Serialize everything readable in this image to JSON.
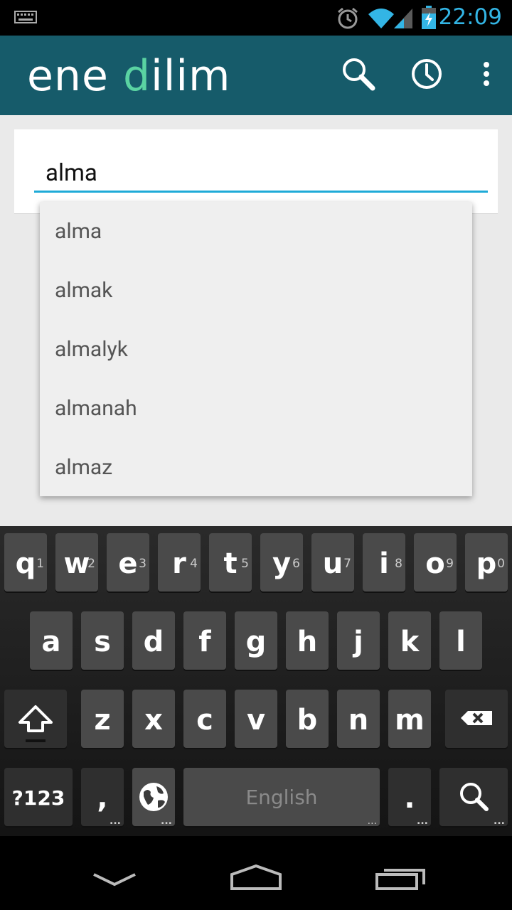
{
  "status_bar": {
    "time": "22:09"
  },
  "app": {
    "logo_part1": "ene ",
    "logo_part2": "d",
    "logo_part3": "ilim"
  },
  "search": {
    "value": "alma"
  },
  "suggestions": [
    "alma",
    "almak",
    "almalyk",
    "almanah",
    "almaz"
  ],
  "keyboard": {
    "row1": [
      {
        "k": "q",
        "h": "1"
      },
      {
        "k": "w",
        "h": "2"
      },
      {
        "k": "e",
        "h": "3"
      },
      {
        "k": "r",
        "h": "4"
      },
      {
        "k": "t",
        "h": "5"
      },
      {
        "k": "y",
        "h": "6"
      },
      {
        "k": "u",
        "h": "7"
      },
      {
        "k": "i",
        "h": "8"
      },
      {
        "k": "o",
        "h": "9"
      },
      {
        "k": "p",
        "h": "0"
      }
    ],
    "row2": [
      "a",
      "s",
      "d",
      "f",
      "g",
      "h",
      "j",
      "k",
      "l"
    ],
    "row3": [
      "z",
      "x",
      "c",
      "v",
      "b",
      "n",
      "m"
    ],
    "symbols_label": "?123",
    "comma_label": ",",
    "space_label": "English",
    "period_label": "."
  },
  "colors": {
    "app_bar": "#165b6a",
    "logo_accent": "#5ad3a2",
    "status_time": "#33b5e5",
    "input_underline": "#1eaad7"
  }
}
